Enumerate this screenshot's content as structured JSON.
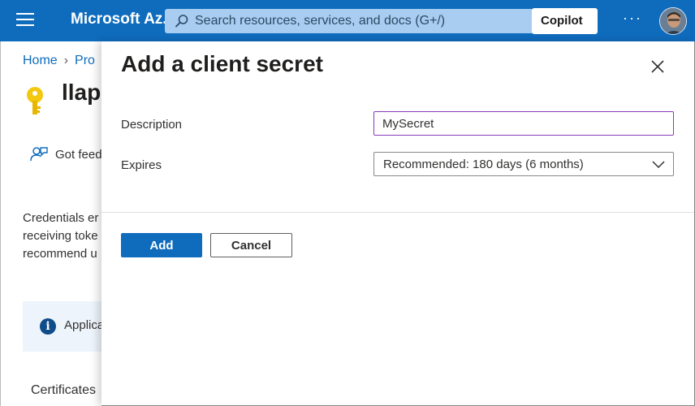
{
  "topbar": {
    "menu_icon": "hamburger-icon",
    "brand": "Microsoft Az...",
    "search_placeholder": "Search resources, services, and docs (G+/)",
    "search_icon": "search-icon",
    "copilot_label": "Copilot",
    "more_label": "···",
    "colors": {
      "bar": "#0f6cbd",
      "search_bg": "#a8cdf0"
    }
  },
  "background_page": {
    "breadcrumb": [
      "Home",
      "Pro"
    ],
    "title": "llap",
    "title_icon": "key-icon",
    "feedback_label": "Got feed",
    "feedback_icon": "feedback-icon",
    "description_lines": [
      "Credentials er",
      "receiving toke",
      "recommend u"
    ],
    "info_text": "Applica",
    "info_icon": "info-icon",
    "certificates_label": "Certificates"
  },
  "panel": {
    "title": "Add a client secret",
    "close_icon": "close-icon",
    "description_label": "Description",
    "description_value": "MySecret",
    "expires_label": "Expires",
    "expires_value": "Recommended: 180 days (6 months)",
    "add_label": "Add",
    "cancel_label": "Cancel",
    "colors": {
      "primary": "#0f6cbd",
      "input_focus_border": "#8a3ab9"
    }
  }
}
